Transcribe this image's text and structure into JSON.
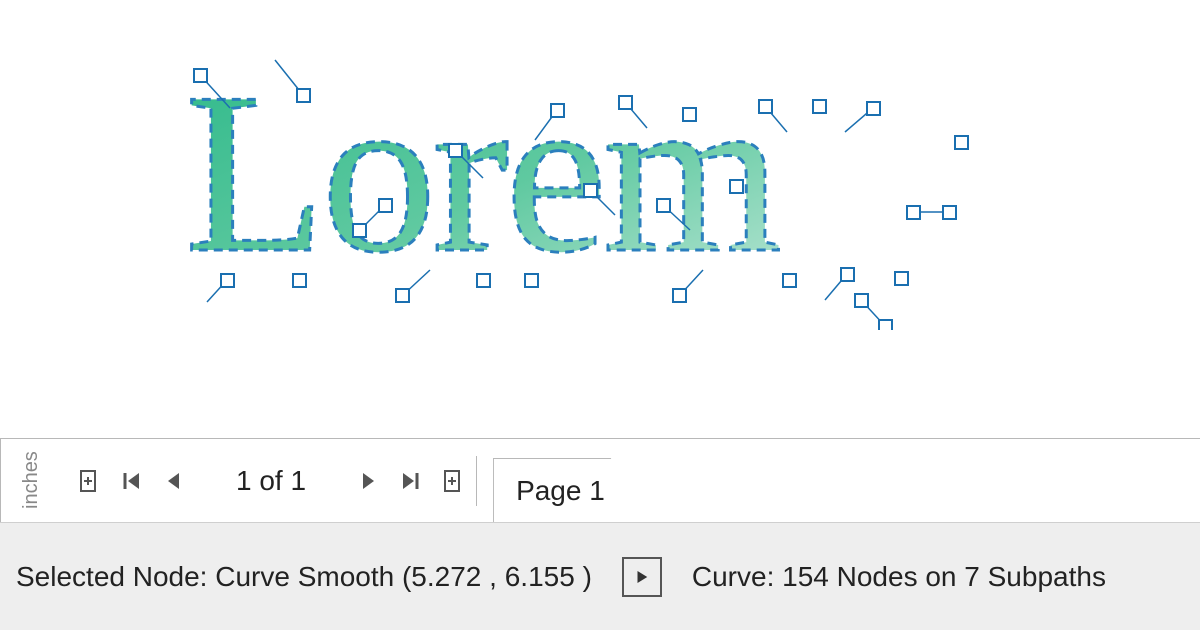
{
  "canvas": {
    "artwork_text": "Lorem",
    "colors": {
      "fill_start": "#2eb98a",
      "fill_end": "#9fd9c4",
      "node_stroke": "#1a6fb0",
      "dash_stroke": "#2b7fbd"
    }
  },
  "ruler": {
    "unit_label": "inches"
  },
  "pagenav": {
    "page_count_label": "1 of 1",
    "current_tab_label": "Page 1"
  },
  "status": {
    "selected_node_text": "Selected Node: Curve Smooth (5.272 , 6.155 )",
    "curve_info_text": "Curve: 154 Nodes on 7 Subpaths",
    "node_type": "Curve Smooth",
    "node_x": 5.272,
    "node_y": 6.155,
    "node_count": 154,
    "subpath_count": 7
  }
}
